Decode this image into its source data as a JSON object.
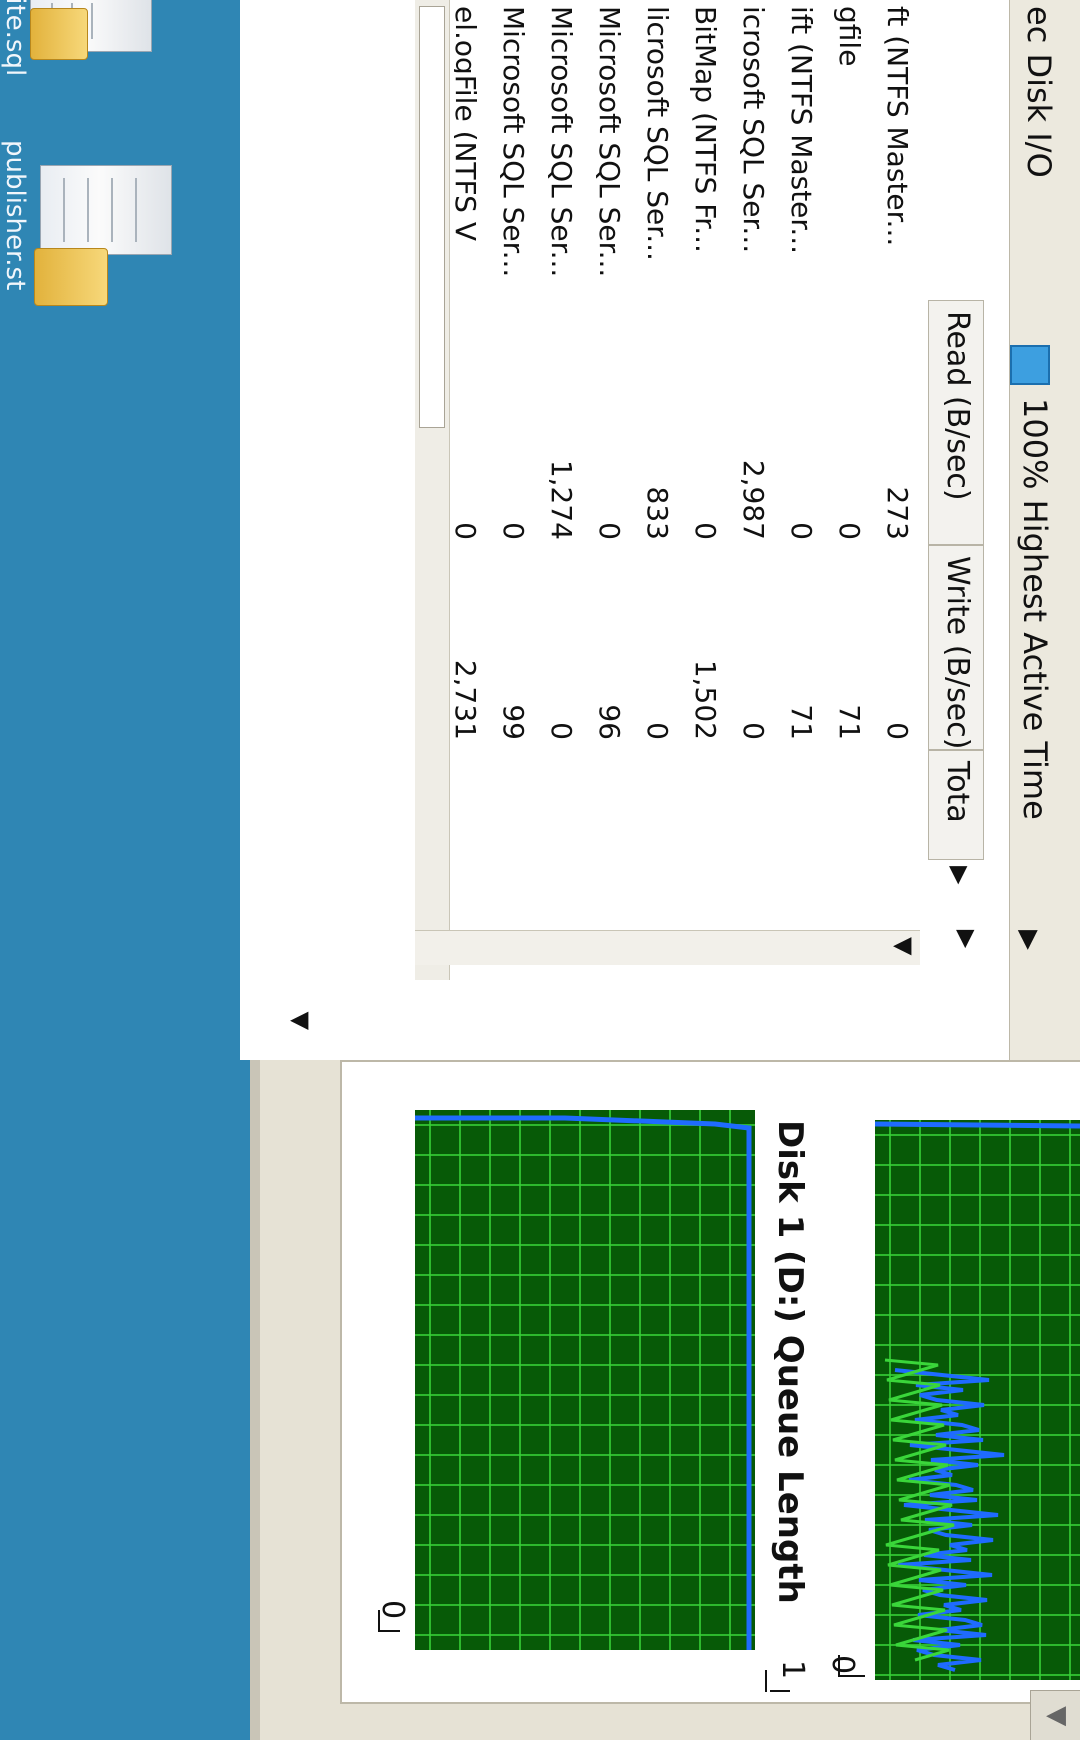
{
  "desktop": {
    "icon_labels": [
      "lite.sql",
      "publisher.st"
    ]
  },
  "process_panel": {
    "title": "ec Disk I/O",
    "legend": {
      "text": "100% Highest Active Time",
      "color": "#3d9fe0"
    },
    "columns": {
      "read": "Read (B/sec)",
      "write": "Write (B/sec)",
      "total": "Tota"
    },
    "rows": [
      {
        "name": "ft (NTFS Master...",
        "read": "273",
        "write": "0"
      },
      {
        "name": "gfile",
        "read": "0",
        "write": "71"
      },
      {
        "name": "ift (NTFS Master...",
        "read": "0",
        "write": "71"
      },
      {
        "name": "icrosoft SQL Ser...",
        "read": "2,987",
        "write": "0"
      },
      {
        "name": "BitMap (NTFS Fr...",
        "read": "0",
        "write": "1,502"
      },
      {
        "name": "licrosoft SQL Ser...",
        "read": "833",
        "write": "0"
      },
      {
        "name": "Microsoft SQL Ser...",
        "read": "0",
        "write": "96"
      },
      {
        "name": "Microsoft SQL Ser...",
        "read": "1,274",
        "write": "0"
      },
      {
        "name": "Microsoft SQL Ser...",
        "read": "0",
        "write": "99"
      },
      {
        "name": "el.ogFile (NTFS V",
        "read": "0",
        "write": "2,731"
      }
    ]
  },
  "graphs": {
    "queue_graph": {
      "title": "Disk 1 (D:) Queue Length",
      "max_label": "1",
      "min_label": "0",
      "colors": {
        "background": "#075a07",
        "grid": "#37d137",
        "line": "#1f6bff"
      }
    },
    "activity_graph": {
      "max_label": "",
      "min_label": "0",
      "colors": {
        "background": "#075a07",
        "grid": "#37d137",
        "line_a": "#1f6bff",
        "line_b": "#3ad63a"
      }
    }
  }
}
